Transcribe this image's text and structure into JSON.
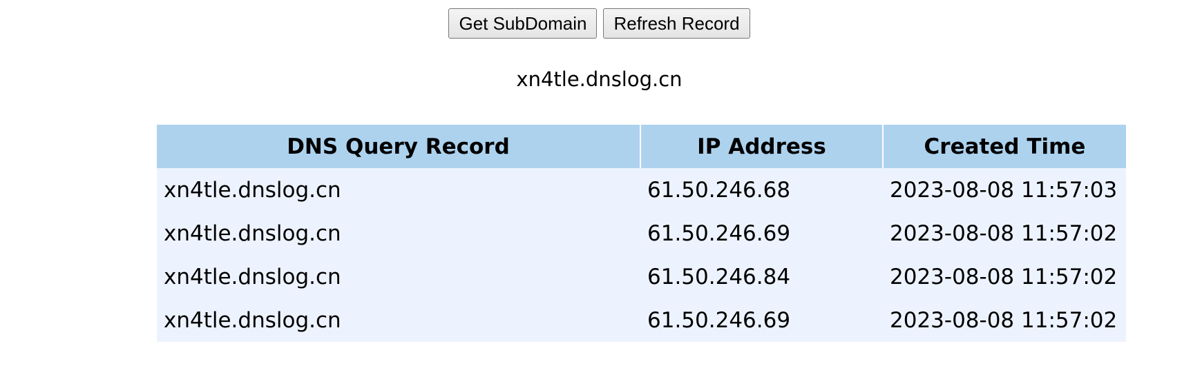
{
  "toolbar": {
    "get_subdomain_label": "Get SubDomain",
    "refresh_record_label": "Refresh Record"
  },
  "subdomain": "xn4tle.dnslog.cn",
  "table": {
    "headers": [
      "DNS Query Record",
      "IP Address",
      "Created Time"
    ],
    "rows": [
      [
        "xn4tle.dnslog.cn",
        "61.50.246.68",
        "2023-08-08 11:57:03"
      ],
      [
        "xn4tle.dnslog.cn",
        "61.50.246.69",
        "2023-08-08 11:57:02"
      ],
      [
        "xn4tle.dnslog.cn",
        "61.50.246.84",
        "2023-08-08 11:57:02"
      ],
      [
        "xn4tle.dnslog.cn",
        "61.50.246.69",
        "2023-08-08 11:57:02"
      ]
    ]
  },
  "colors": {
    "header_bg": "#add2ee",
    "row_bg": "#edf3fe"
  }
}
